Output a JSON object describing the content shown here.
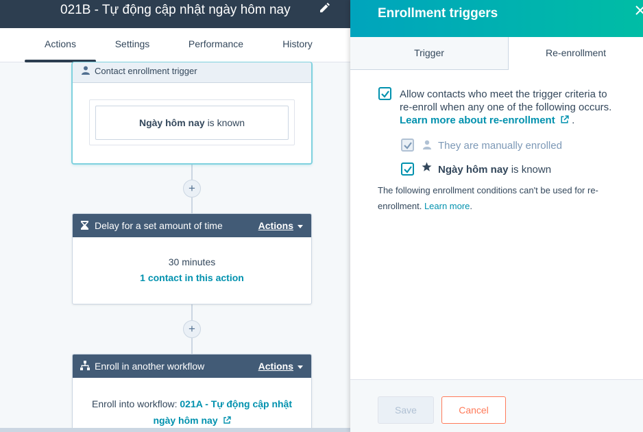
{
  "workflow": {
    "title": "021B - Tự động cập nhật ngày hôm nay"
  },
  "tabs": [
    {
      "label": "Actions"
    },
    {
      "label": "Settings"
    },
    {
      "label": "Performance"
    },
    {
      "label": "History"
    }
  ],
  "trigger_card": {
    "header": "Contact enrollment trigger",
    "property": "Ngày hôm nay",
    "condition": "is known"
  },
  "delay_card": {
    "header": "Delay for a set amount of time",
    "actions_label": "Actions",
    "duration": "30 minutes",
    "contacts_link": "1 contact in this action"
  },
  "enroll_card": {
    "header": "Enroll in another workflow",
    "actions_label": "Actions",
    "prefix": "Enroll into workflow:",
    "workflow_line1": "021A - Tự động cập nhật",
    "workflow_line2": "ngày hôm nay"
  },
  "plus_label": "+",
  "panel": {
    "title": "Enrollment triggers",
    "tabs": [
      {
        "label": "Trigger"
      },
      {
        "label": "Re-enrollment"
      }
    ],
    "allow_line1": "Allow contacts who meet the trigger criteria to",
    "allow_line2": "re-enroll when any one of the following occurs.",
    "learn_more_reenroll": "Learn more about re-enrollment",
    "period": ".",
    "manual_label": "They are manually enrolled",
    "property_label": "Ngày hôm nay",
    "property_condition": "is known",
    "note_line1": "The following enrollment conditions can't be used for re-",
    "note_line2": "enrollment.",
    "learn_more": "Learn more",
    "save_label": "Save",
    "cancel_label": "Cancel"
  },
  "colors": {
    "header_dark": "#2d3e50",
    "action_header": "#425b76",
    "teal": "#0091ae",
    "panel_gradient_start": "#00a4bd",
    "panel_gradient_end": "#00bda5",
    "cancel_orange": "#ff7a59"
  }
}
